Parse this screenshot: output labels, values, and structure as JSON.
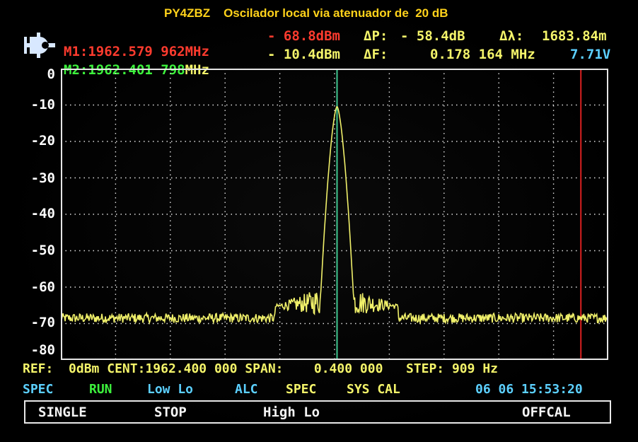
{
  "title": "PY4ZBZ    Oscilador local via atenuador de  20 dB",
  "markers": {
    "m1": {
      "label": "M1:",
      "freq": "1962.579 962",
      "unit": "MHz",
      "level": "- 68.8dBm"
    },
    "m2": {
      "label": "M2:",
      "freq": "1962.401 798",
      "unit": "MHz",
      "level": "- 10.4dBm"
    }
  },
  "deltas": {
    "dp_label": "ΔP:",
    "dp_value": "- 58.4dB",
    "dl_label": "Δλ:",
    "dl_value": "1683.84m",
    "df_label": "ΔF:",
    "df_value": "0.178 164 MHz",
    "voltage": "7.71V"
  },
  "y_axis": [
    "0",
    "-10",
    "-20",
    "-30",
    "-40",
    "-50",
    "-60",
    "-70",
    "-80"
  ],
  "settings": {
    "ref_label": "REF:",
    "ref_value": "0dBm",
    "cent_label": "CENT:",
    "cent_value": "1962.400 000",
    "span_label": "SPAN:",
    "span_value": "0.400 000",
    "step_label": "STEP:",
    "step_value": "909 Hz"
  },
  "status": {
    "spec": "SPEC",
    "run": "RUN",
    "low_lo": "Low Lo",
    "alc": "ALC",
    "spec2": "SPEC",
    "sys_cal": "SYS CAL",
    "datetime": "06 06 15:53:20"
  },
  "softkeys": {
    "single": "SINGLE",
    "stop": "STOP",
    "high_lo": "High Lo",
    "offcal": "OFFCAL"
  },
  "colors": {
    "trace": "#f0f06a",
    "grid": "#e0e0e0",
    "marker1": "#d82020",
    "marker2": "#40c890"
  },
  "chart_data": {
    "type": "line",
    "ylim": [
      -80,
      0
    ],
    "xlim": [
      1962.2,
      1962.6
    ],
    "peak": {
      "x": 1962.4018,
      "y": -10.4
    },
    "noise_floor": -68.5,
    "marker_lines": [
      1962.4018,
      1962.57996
    ]
  }
}
